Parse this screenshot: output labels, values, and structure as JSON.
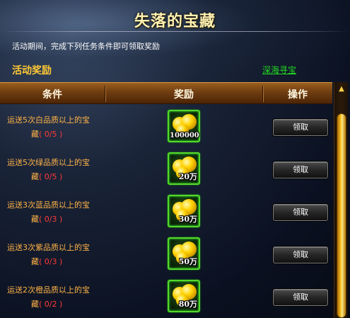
{
  "title": "失落的宝藏",
  "description": "活动期间，完成下列任务条件即可领取奖励",
  "section": {
    "title": "活动奖励",
    "link": "深海寻宝"
  },
  "columns": {
    "condition": "条件",
    "reward": "奖励",
    "action": "操作"
  },
  "rows": [
    {
      "text1": "运送5次白品质以上的宝",
      "text2": "藏",
      "count": "( 0/5 )",
      "reward": "100000",
      "button": "领取"
    },
    {
      "text1": "运送5次绿品质以上的宝",
      "text2": "藏",
      "count": "( 0/5 )",
      "reward": "20万",
      "button": "领取"
    },
    {
      "text1": "运送3次蓝品质以上的宝",
      "text2": "藏",
      "count": "( 0/3 )",
      "reward": "30万",
      "button": "领取"
    },
    {
      "text1": "运送3次紫品质以上的宝",
      "text2": "藏",
      "count": "( 0/3 )",
      "reward": "50万",
      "button": "领取"
    },
    {
      "text1": "运送2次橙品质以上的宝",
      "text2": "藏",
      "count": "( 0/2 )",
      "reward": "80万",
      "button": "领取"
    }
  ],
  "icons": {
    "reward": "gold-coins-icon",
    "scroll_up": "arrow-up-icon"
  },
  "colors": {
    "accent": "#ffc933",
    "condition_text": "#ffb347",
    "count_text": "#ff3a3a",
    "link": "#22dd22"
  }
}
